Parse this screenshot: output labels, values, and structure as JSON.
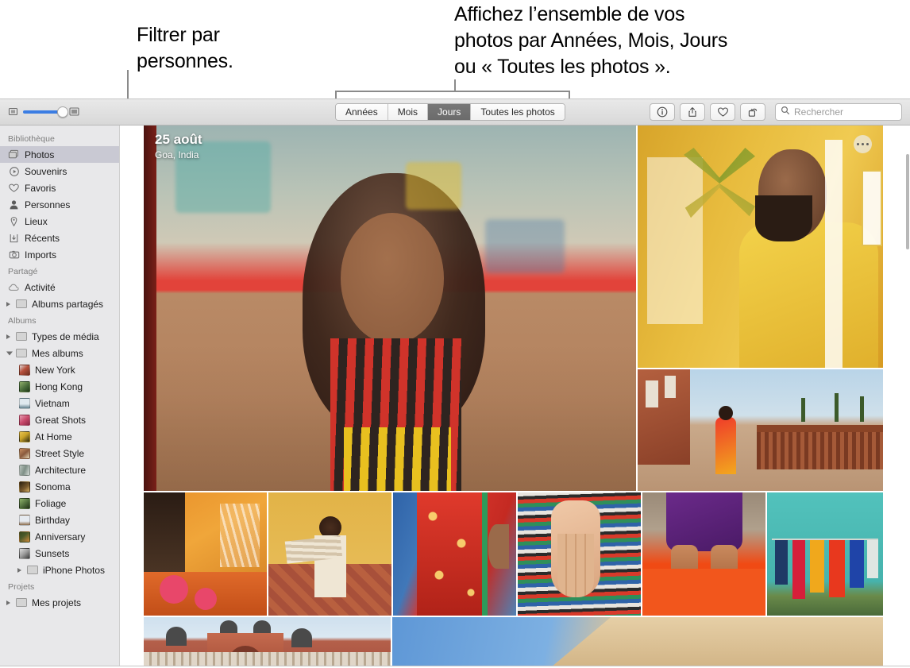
{
  "callouts": {
    "people": "Filtrer par\npersonnes.",
    "browse": "Affichez l’ensemble de vos\nphotos par Années, Mois, Jours\nou « Toutes les photos »."
  },
  "toolbar": {
    "zoom_small_icon": "small-thumbnail-icon",
    "zoom_large_icon": "large-thumbnail-icon",
    "zoom_value": 82,
    "segments": [
      {
        "label": "Années",
        "selected": false
      },
      {
        "label": "Mois",
        "selected": false
      },
      {
        "label": "Jours",
        "selected": true
      },
      {
        "label": "Toutes les photos",
        "selected": false
      }
    ],
    "actions": [
      {
        "name": "info-icon",
        "label": "Informations"
      },
      {
        "name": "share-icon",
        "label": "Partager"
      },
      {
        "name": "heart-icon",
        "label": "Favori"
      },
      {
        "name": "rotate-icon",
        "label": "Faire pivoter"
      }
    ],
    "search": {
      "placeholder": "Rechercher",
      "value": "",
      "icon": "search-icon"
    }
  },
  "sidebar": {
    "sections": [
      {
        "header": "Bibliothèque",
        "items": [
          {
            "label": "Photos",
            "icon": "photos-icon",
            "selected": true
          },
          {
            "label": "Souvenirs",
            "icon": "memories-icon",
            "selected": false
          },
          {
            "label": "Favoris",
            "icon": "heart-icon",
            "selected": false
          },
          {
            "label": "Personnes",
            "icon": "person-icon",
            "selected": false
          },
          {
            "label": "Lieux",
            "icon": "pin-icon",
            "selected": false
          },
          {
            "label": "Récents",
            "icon": "recents-icon",
            "selected": false
          },
          {
            "label": "Imports",
            "icon": "camera-icon",
            "selected": false
          }
        ]
      },
      {
        "header": "Partagé",
        "items": [
          {
            "label": "Activité",
            "icon": "cloud-icon",
            "selected": false
          },
          {
            "label": "Albums partagés",
            "icon": "folder-icon",
            "selected": false,
            "disclosure": "closed"
          }
        ]
      },
      {
        "header": "Albums",
        "items": [
          {
            "label": "Types de média",
            "icon": "folder-icon",
            "selected": false,
            "disclosure": "closed"
          },
          {
            "label": "Mes albums",
            "icon": "folder-icon",
            "selected": false,
            "disclosure": "open"
          }
        ],
        "children": [
          {
            "label": "New York",
            "icon": "album-thumb",
            "color": "#b8503c"
          },
          {
            "label": "Hong Kong",
            "icon": "album-thumb",
            "color": "#486b3a"
          },
          {
            "label": "Vietnam",
            "icon": "album-thumb",
            "color": "#9dbac9"
          },
          {
            "label": "Great Shots",
            "icon": "album-thumb",
            "color": "#c9496b"
          },
          {
            "label": "At Home",
            "icon": "album-thumb",
            "color": "#c9a227"
          },
          {
            "label": "Street Style",
            "icon": "album-thumb",
            "color": "#8a5a3c"
          },
          {
            "label": "Architecture",
            "icon": "album-thumb",
            "color": "#7e8f86"
          },
          {
            "label": "Sonoma",
            "icon": "album-thumb",
            "color": "#7a5a2e"
          },
          {
            "label": "Foliage",
            "icon": "album-thumb",
            "color": "#4d6b3a"
          },
          {
            "label": "Birthday",
            "icon": "album-thumb",
            "color": "#cbd4dd"
          },
          {
            "label": "Anniversary",
            "icon": "album-thumb",
            "color": "#4a5a2a"
          },
          {
            "label": "Sunsets",
            "icon": "album-thumb",
            "color": "#b0b0b0"
          },
          {
            "label": "iPhone Photos",
            "icon": "folder-icon",
            "disclosure": "closed"
          }
        ]
      },
      {
        "header": "Projets",
        "items": [
          {
            "label": "Mes projets",
            "icon": "folder-icon",
            "selected": false,
            "disclosure": "closed"
          }
        ]
      }
    ]
  },
  "photo_grid": {
    "overlay": {
      "date": "25 août",
      "place": "Goa, India"
    },
    "more_button_label": "Plus d’options"
  }
}
